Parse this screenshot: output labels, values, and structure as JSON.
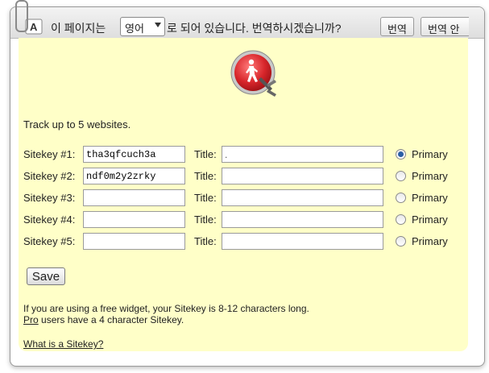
{
  "translate_bar": {
    "icon_label": "A",
    "prefix_text": "이 페이지는",
    "language": "영어",
    "suffix_text": "로 되어 있습니다. 번역하시겠습니까?",
    "translate_button": "번역",
    "second_button": "번역 안"
  },
  "intro": "Track up to 5 websites.",
  "title_label": "Title:",
  "primary_label": "Primary",
  "rows": [
    {
      "label": "Sitekey #1:",
      "key": "tha3qfcuch3a",
      "title": ".",
      "selected": true
    },
    {
      "label": "Sitekey #2:",
      "key": "ndf0m2y2zrky",
      "title": "",
      "selected": false
    },
    {
      "label": "Sitekey #3:",
      "key": "",
      "title": "",
      "selected": false
    },
    {
      "label": "Sitekey #4:",
      "key": "",
      "title": "",
      "selected": false
    },
    {
      "label": "Sitekey #5:",
      "key": "",
      "title": "",
      "selected": false
    }
  ],
  "save_label": "Save",
  "note": {
    "line1": "If you are using a free widget, your Sitekey is 8-12 characters long.",
    "pro_link": "Pro",
    "line2_rest": " users have a 4 character Sitekey."
  },
  "help_link": "What is a Sitekey?",
  "colors": {
    "content_bg": "#ffffc8",
    "radio_selected": "#2b5fa5",
    "logo_red": "#d8262b"
  }
}
